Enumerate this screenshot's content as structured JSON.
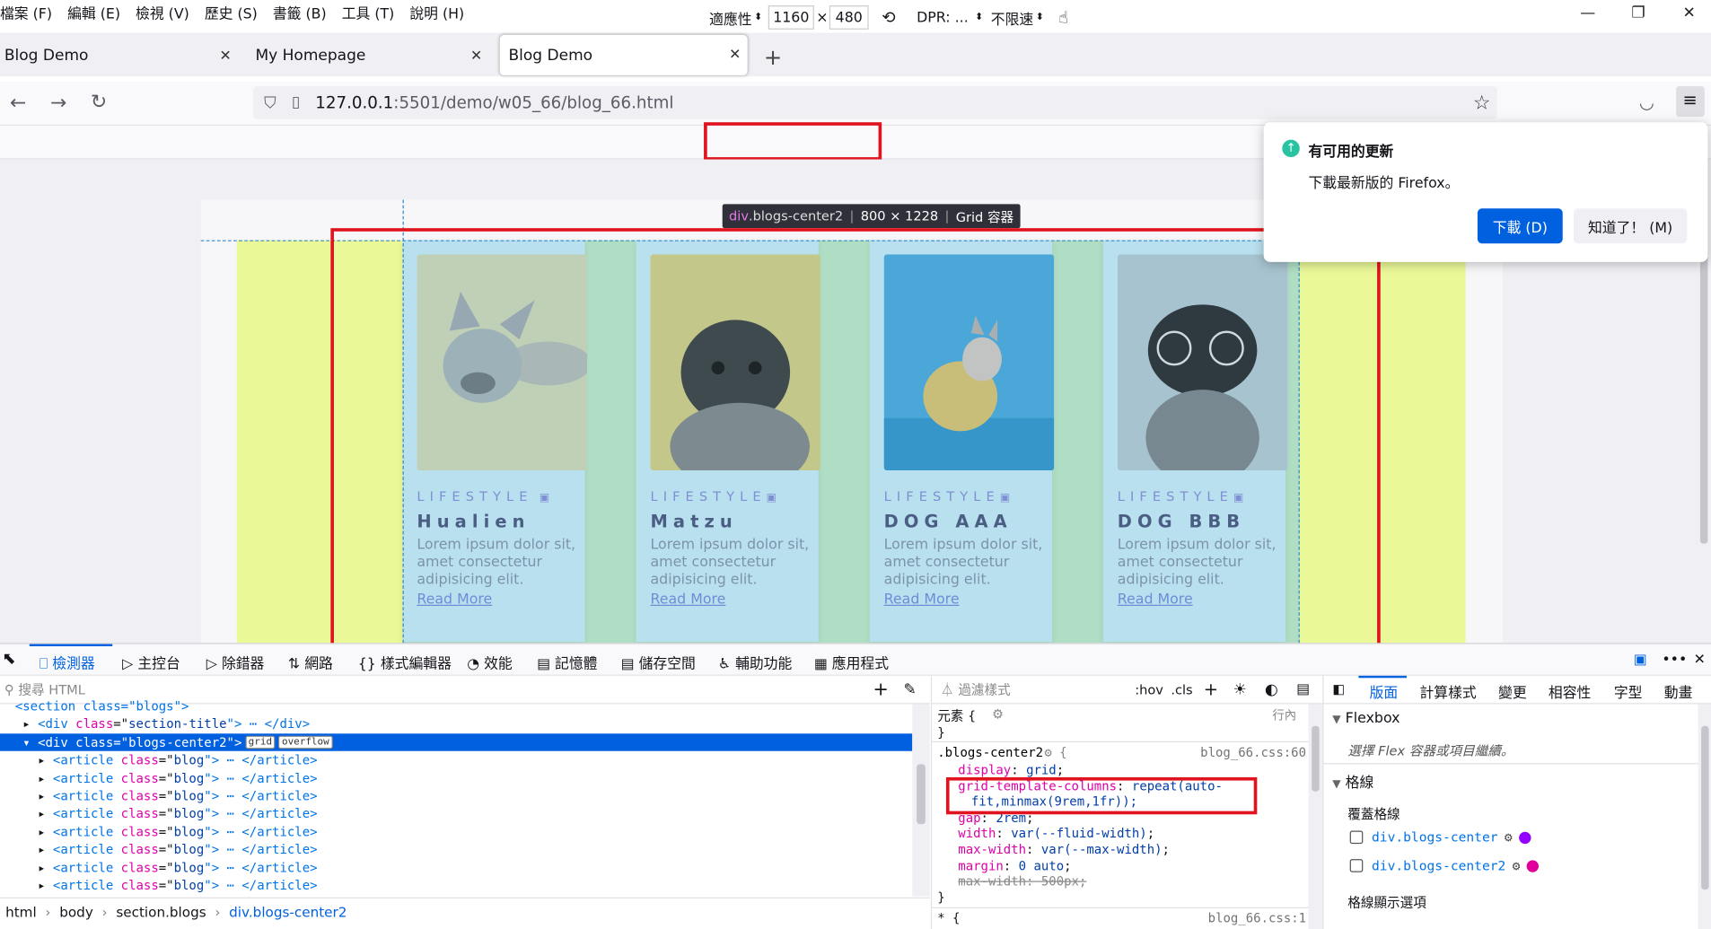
{
  "menu": [
    "檔案 (F)",
    "編輯 (E)",
    "檢視 (V)",
    "歷史 (S)",
    "書籤 (B)",
    "工具 (T)",
    "說明 (H)"
  ],
  "window_controls": {
    "minimize": "—",
    "restore": "❐",
    "close": "✕"
  },
  "tabs": [
    {
      "label": "Blog Demo",
      "close": "✕"
    },
    {
      "label": "My Homepage",
      "close": "✕"
    },
    {
      "label": "Blog Demo",
      "close": "✕"
    }
  ],
  "new_tab": "+",
  "url": {
    "host": "127.0.0.1",
    "path": ":5501/demo/w05_66/blog_66.html"
  },
  "rdm": {
    "device": "適應性",
    "width": "1160",
    "times": "×",
    "height": "480",
    "dpr": "DPR: ...",
    "throttle": "不限速"
  },
  "grid_label": {
    "tag": "div",
    "cls": ".blogs-center2",
    "size": "800 × 1228",
    "type": "Grid 容器"
  },
  "cards": [
    {
      "category": "LIFESTYLE",
      "title": "Hualien",
      "desc": "Lorem ipsum dolor sit, amet consectetur adipisicing elit.",
      "link": "Read More",
      "photo": "french-bulldog-lying"
    },
    {
      "category": "LIFESTYLE",
      "title": "Matzu",
      "desc": "Lorem ipsum dolor sit, amet consectetur adipisicing elit.",
      "link": "Read More",
      "photo": "pug-in-sweater"
    },
    {
      "category": "LIFESTYLE",
      "title": "DOG AAA",
      "desc": "Lorem ipsum dolor sit, amet consectetur adipisicing elit.",
      "link": "Read More",
      "photo": "bulldog-yellow-hoodie"
    },
    {
      "category": "LIFESTYLE",
      "title": "DOG BBB",
      "desc": "Lorem ipsum dolor sit, amet consectetur adipisicing elit.",
      "link": "Read More",
      "photo": "pug-with-glasses"
    }
  ],
  "notification": {
    "title": "有可用的更新",
    "body": "下載最新版的 Firefox。",
    "primary": "下載 (D)",
    "secondary": "知道了！ (M)"
  },
  "devtools_tabs": [
    "檢測器",
    "主控台",
    "除錯器",
    "網路",
    "樣式編輯器",
    "效能",
    "記憶體",
    "儲存空間",
    "輔助功能",
    "應用程式"
  ],
  "markup": {
    "search_placeholder": "搜尋 HTML",
    "rows": [
      {
        "indent": "  ",
        "text": "<section class=\"blogs\">",
        "partial": true
      },
      {
        "indent": "   ",
        "tag": "div",
        "attr": "class",
        "val": "section-title",
        "tail": " ⋯ </div>",
        "arrow": "▸"
      },
      {
        "indent": "   ",
        "tag": "div",
        "attr": "class",
        "val": "blogs-center2",
        "tail": "",
        "arrow": "▾",
        "badges": [
          "grid",
          "overflow"
        ],
        "selected": true
      },
      {
        "indent": "     ",
        "tag": "article",
        "attr": "class",
        "val": "blog",
        "tail": " ⋯ </article>",
        "arrow": "▸"
      },
      {
        "indent": "     ",
        "tag": "article",
        "attr": "class",
        "val": "blog",
        "tail": " ⋯ </article>",
        "arrow": "▸"
      },
      {
        "indent": "     ",
        "tag": "article",
        "attr": "class",
        "val": "blog",
        "tail": " ⋯ </article>",
        "arrow": "▸"
      },
      {
        "indent": "     ",
        "tag": "article",
        "attr": "class",
        "val": "blog",
        "tail": " ⋯ </article>",
        "arrow": "▸"
      },
      {
        "indent": "     ",
        "tag": "article",
        "attr": "class",
        "val": "blog",
        "tail": " ⋯ </article>",
        "arrow": "▸"
      },
      {
        "indent": "     ",
        "tag": "article",
        "attr": "class",
        "val": "blog",
        "tail": " ⋯ </article>",
        "arrow": "▸"
      },
      {
        "indent": "     ",
        "tag": "article",
        "attr": "class",
        "val": "blog",
        "tail": " ⋯ </article>",
        "arrow": "▸"
      },
      {
        "indent": "     ",
        "tag": "article",
        "attr": "class",
        "val": "blog",
        "tail": " ⋯ </article>",
        "arrow": "▸"
      }
    ]
  },
  "breadcrumb": [
    "html",
    "body",
    "section.blogs",
    "div.blogs-center2"
  ],
  "rules": {
    "filter_placeholder": "過濾樣式",
    "hov": ":hov",
    "cls": ".cls",
    "element_label": "元素 {",
    "inline": "行內",
    "close": "}",
    "selector": ".blogs-center2",
    "file": "blog_66.css:60",
    "decls": [
      {
        "p": "display",
        "v": "grid"
      },
      {
        "p": "grid-template-columns",
        "v": "repeat(auto-",
        "v2": "fit,minmax(9rem,1fr));"
      },
      {
        "p": "gap",
        "v": "2rem"
      },
      {
        "p": "width",
        "v": "var(--fluid-width)"
      },
      {
        "p": "max-width",
        "v": "var(--max-width)"
      },
      {
        "p": "margin",
        "v": "0 auto"
      },
      {
        "p": "max-width",
        "v": "500px",
        "struck": true
      }
    ],
    "next_selector": "* {",
    "next_file": "blog_66.css:1"
  },
  "layout": {
    "tabs": [
      "版面",
      "計算樣式",
      "變更",
      "相容性",
      "字型",
      "動畫"
    ],
    "flex_header": "Flexbox",
    "flex_hint": "選擇 Flex 容器或項目繼續。",
    "grid_header": "格線",
    "overlay_label": "覆蓋格線",
    "grids": [
      {
        "name": "div.blogs-center",
        "color": "#9400ff"
      },
      {
        "name": "div.blogs-center2",
        "color": "#e0009b"
      }
    ],
    "display_options": "格線顯示選項"
  },
  "colors": {
    "accent": "#0061e0",
    "highlight_red": "#e0141e",
    "yellow": "#ebf898"
  }
}
